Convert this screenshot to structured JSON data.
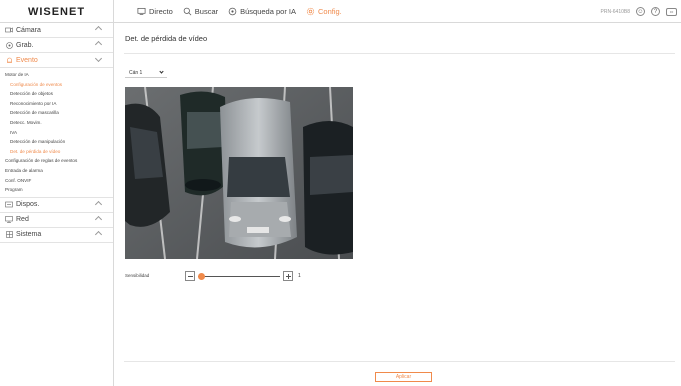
{
  "app": {
    "logo": "WISENET"
  },
  "nav": {
    "items": [
      {
        "label": "Directo",
        "icon": "monitor-icon"
      },
      {
        "label": "Buscar",
        "icon": "search-icon"
      },
      {
        "label": "Búsqueda por IA",
        "icon": "ai-search-icon"
      },
      {
        "label": "Config.",
        "icon": "gear-icon",
        "active": true
      }
    ],
    "model": "PRN-6410B8",
    "accent": "#f08a4b"
  },
  "sidebar": {
    "camara": "Cámara",
    "grab": "Grab.",
    "evento": "Evento",
    "evento_items": [
      "Motor de IA",
      "Configuración de eventos",
      "Detección de objetos",
      "Reconocimiento por IA",
      "Detección de mascarilla",
      "Detecc. Movim.",
      "IVA",
      "Detección de manipulación",
      "Det. de pérdida de vídeo",
      "Configuración de reglas de eventos",
      "Entrada de alarma",
      "Conf. ONVIF",
      "Program"
    ],
    "dispos": "Dispos.",
    "red": "Red",
    "sistema": "Sistema"
  },
  "main": {
    "title": "Det. de pérdida de vídeo",
    "camera_select": "Cán 1",
    "sensitivity_label": "Sensibilidad",
    "sensitivity_value": "1",
    "apply_label": "Aplicar"
  }
}
